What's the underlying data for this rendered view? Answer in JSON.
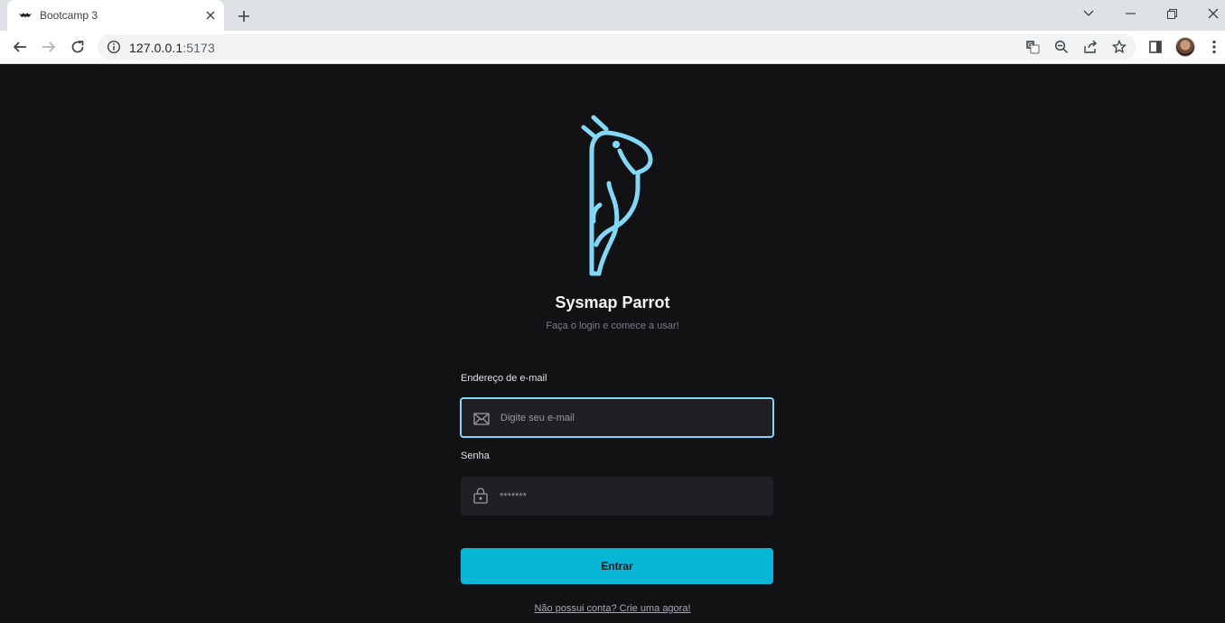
{
  "browser": {
    "tab": {
      "title": "Bootcamp 3",
      "favicon": "bat-icon"
    },
    "url": {
      "host": "127.0.0.1",
      "port": ":5173"
    },
    "icons": [
      "back-icon",
      "forward-icon",
      "reload-icon",
      "info-icon",
      "translate-icon",
      "zoom-icon",
      "share-icon",
      "star-icon",
      "sidepanel-icon",
      "avatar",
      "kebab-menu-icon"
    ]
  },
  "app": {
    "title": "Sysmap Parrot",
    "subtitle": "Faça o login e comece a usar!",
    "email": {
      "label": "Endereço de e-mail",
      "placeholder": "Digite seu e-mail",
      "value": ""
    },
    "password": {
      "label": "Senha",
      "placeholder": "*******",
      "value": ""
    },
    "submit_label": "Entrar",
    "signup_link": "Não possui conta? Crie uma agora!"
  },
  "colors": {
    "background": "#121214",
    "input_bg": "#202024",
    "accent": "#81d8f7",
    "button": "#07b6d5"
  }
}
